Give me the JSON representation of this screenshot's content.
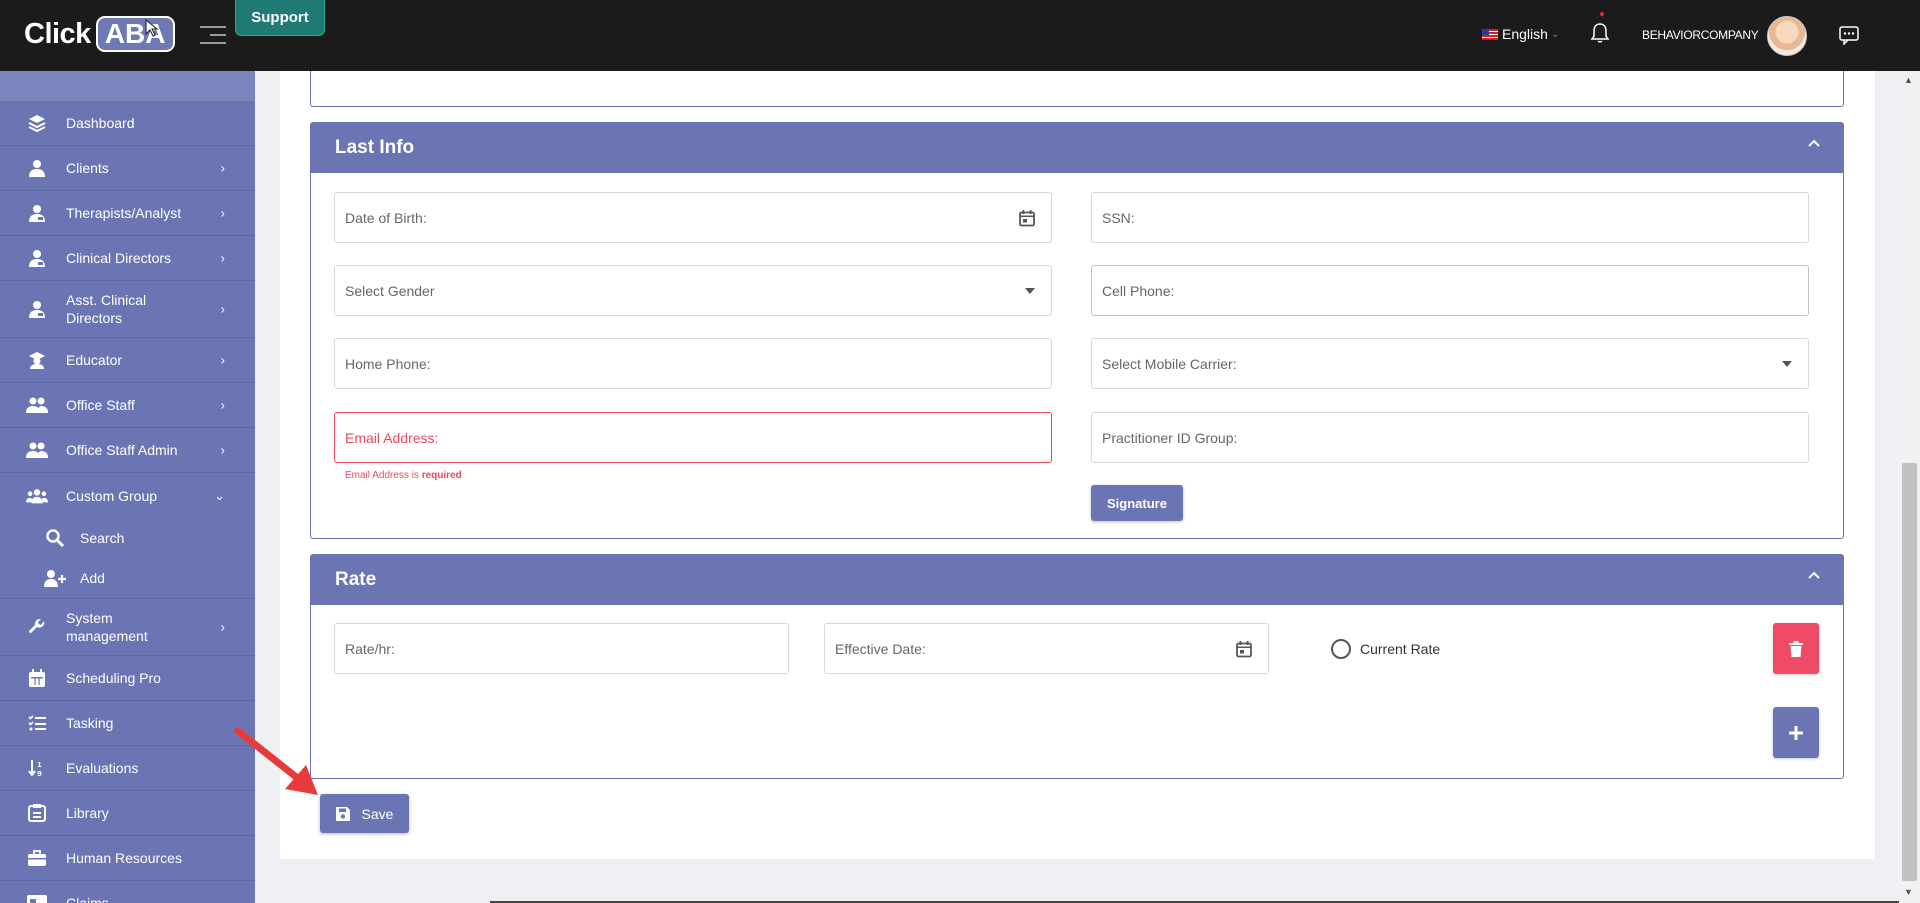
{
  "header": {
    "logo_click": "Click",
    "logo_aba": "ABA",
    "support_label": "Support",
    "language": "English",
    "username": "BEHAVIORCOMPANY"
  },
  "sidebar": {
    "items": [
      {
        "label": "Dashboard",
        "icon": "layers-icon"
      },
      {
        "label": "Clients",
        "icon": "user-icon"
      },
      {
        "label": "Therapists/Analyst",
        "icon": "user-badge-icon"
      },
      {
        "label": "Clinical Directors",
        "icon": "user-badge-icon"
      },
      {
        "label": "Asst. Clinical Directors",
        "icon": "user-badge-icon"
      },
      {
        "label": "Educator",
        "icon": "graduate-icon"
      },
      {
        "label": "Office Staff",
        "icon": "users-icon"
      },
      {
        "label": "Office Staff Admin",
        "icon": "users-icon"
      },
      {
        "label": "Custom Group",
        "icon": "group-icon"
      },
      {
        "label": "System management",
        "icon": "wrench-icon"
      },
      {
        "label": "Scheduling Pro",
        "icon": "calendar-icon"
      },
      {
        "label": "Tasking",
        "icon": "checklist-icon"
      },
      {
        "label": "Evaluations",
        "icon": "sort-icon"
      },
      {
        "label": "Library",
        "icon": "library-icon"
      },
      {
        "label": "Human Resources",
        "icon": "briefcase-icon"
      },
      {
        "label": "Claims",
        "icon": "card-icon"
      }
    ],
    "sub_items": [
      {
        "label": "Search",
        "icon": "search-icon"
      },
      {
        "label": "Add",
        "icon": "user-plus-icon"
      }
    ]
  },
  "last_info": {
    "title": "Last Info",
    "date_of_birth": "Date of Birth:",
    "ssn": "SSN:",
    "gender": "Select Gender",
    "cell_phone": "Cell Phone:",
    "home_phone": "Home Phone:",
    "mobile_carrier": "Select Mobile Carrier:",
    "email": "Email Address:",
    "email_error_prefix": "Email Address is",
    "email_error_required": "required",
    "practitioner_id_group": "Practitioner ID Group:",
    "signature_label": "Signature"
  },
  "rate": {
    "title": "Rate",
    "rate_hr": "Rate/hr:",
    "effective_date": "Effective Date:",
    "current_rate": "Current Rate"
  },
  "save_label": "Save",
  "colors": {
    "topbar": "#1b1b1b",
    "primary": "#6b75b4",
    "support": "#1f7a73",
    "danger": "#ef4a66",
    "error": "#e84a5f"
  }
}
